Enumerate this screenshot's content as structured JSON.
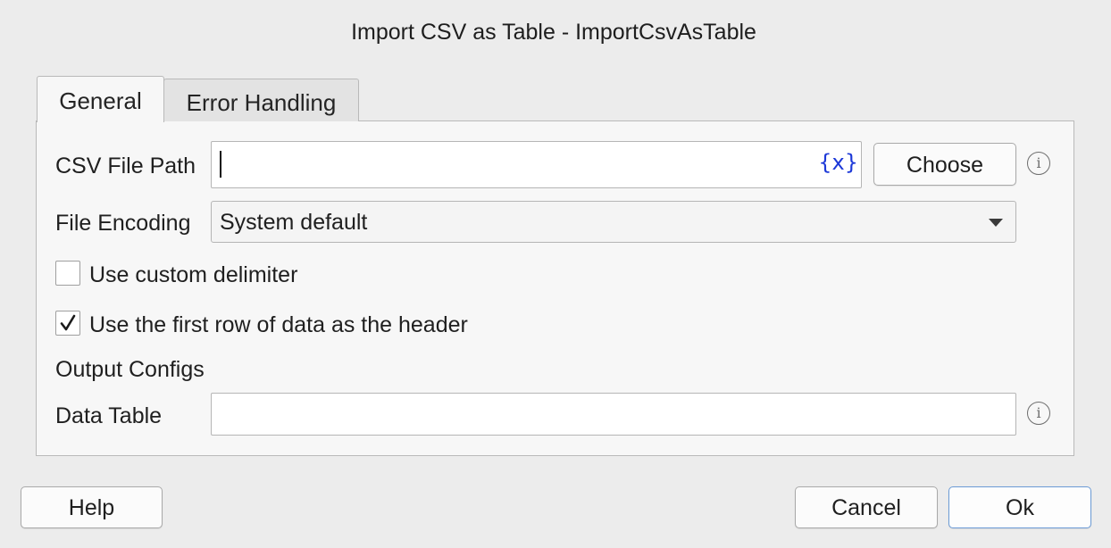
{
  "window": {
    "title": "Import CSV as Table - ImportCsvAsTable"
  },
  "tabs": [
    {
      "label": "General",
      "selected": true
    },
    {
      "label": "Error Handling",
      "selected": false
    }
  ],
  "form": {
    "csv_file_path": {
      "label": "CSV File Path",
      "value": "",
      "variable_icon_text": "{x}",
      "choose_label": "Choose"
    },
    "file_encoding": {
      "label": "File Encoding",
      "selected": "System default"
    },
    "custom_delimiter": {
      "label": "Use custom delimiter",
      "checked": false
    },
    "first_row_header": {
      "label": "Use the first row of data as the header",
      "checked": true
    },
    "output_section": {
      "title": "Output Configs"
    },
    "data_table": {
      "label": "Data Table",
      "value": ""
    }
  },
  "buttons": {
    "help": "Help",
    "cancel": "Cancel",
    "ok": "Ok"
  },
  "icons": {
    "info_glyph": "i"
  }
}
